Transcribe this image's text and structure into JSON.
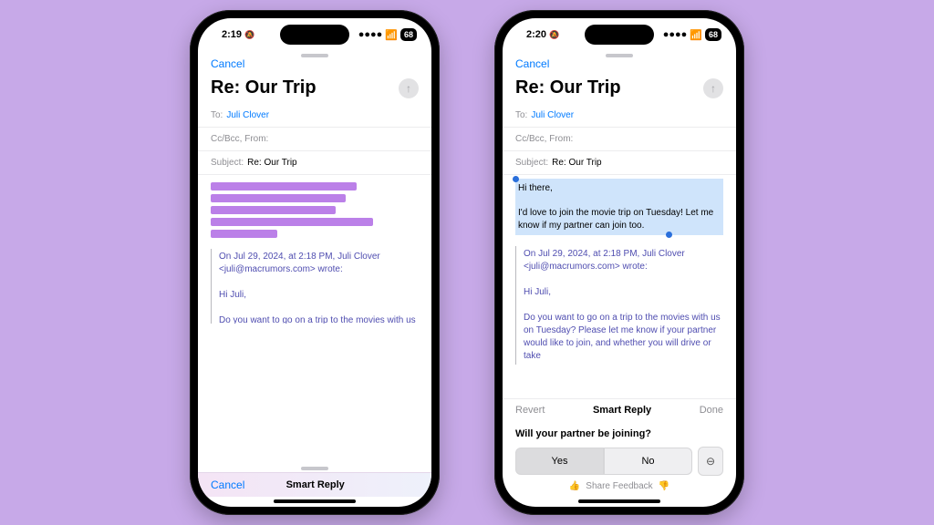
{
  "phone_left": {
    "status": {
      "time": "2:19",
      "bell": "🔕",
      "signal": "▮▮▮▮",
      "wifi": "🔊",
      "battery": "68"
    },
    "compose": {
      "cancel": "Cancel",
      "title": "Re: Our Trip",
      "to_label": "To:",
      "to_recipient": "Juli Clover",
      "ccbcc_label": "Cc/Bcc, From:",
      "subject_label": "Subject:",
      "subject_value": "Re: Our Trip",
      "quote_header": "On Jul 29, 2024, at 2:18 PM, Juli Clover <juli@macrumors.com> wrote:",
      "quote_greeting": "Hi Juli,",
      "quote_body": "Do you want to go on a trip to the movies with us on Tuesday? Please let me know if your partner would like to join, and whether you will drive or take an uber."
    },
    "toolbar": {
      "cancel": "Cancel",
      "title": "Smart Reply"
    },
    "skeleton_widths_pct": [
      70,
      65,
      60,
      78,
      32
    ]
  },
  "phone_right": {
    "status": {
      "time": "2:20",
      "bell": "🔕",
      "signal": "▮▮▮▮",
      "wifi": "🔊",
      "battery": "68"
    },
    "compose": {
      "cancel": "Cancel",
      "title": "Re: Our Trip",
      "to_label": "To:",
      "to_recipient": "Juli Clover",
      "ccbcc_label": "Cc/Bcc, From:",
      "subject_label": "Subject:",
      "subject_value": "Re: Our Trip",
      "selection_greeting": "Hi there,",
      "selection_body": "I'd love to join the movie trip on Tuesday! Let me know if my partner can join too.",
      "quote_header": "On Jul 29, 2024, at 2:18 PM, Juli Clover <juli@macrumors.com> wrote:",
      "quote_greeting": "Hi Juli,",
      "quote_body": "Do you want to go on a trip to the movies with us on Tuesday? Please let me know if your partner would like to join, and whether you will drive or take"
    },
    "toolbar": {
      "revert": "Revert",
      "title": "Smart Reply",
      "done": "Done"
    },
    "prompt": {
      "question": "Will your partner be joining?",
      "option_yes": "Yes",
      "option_no": "No",
      "feedback": "Share Feedback"
    }
  }
}
